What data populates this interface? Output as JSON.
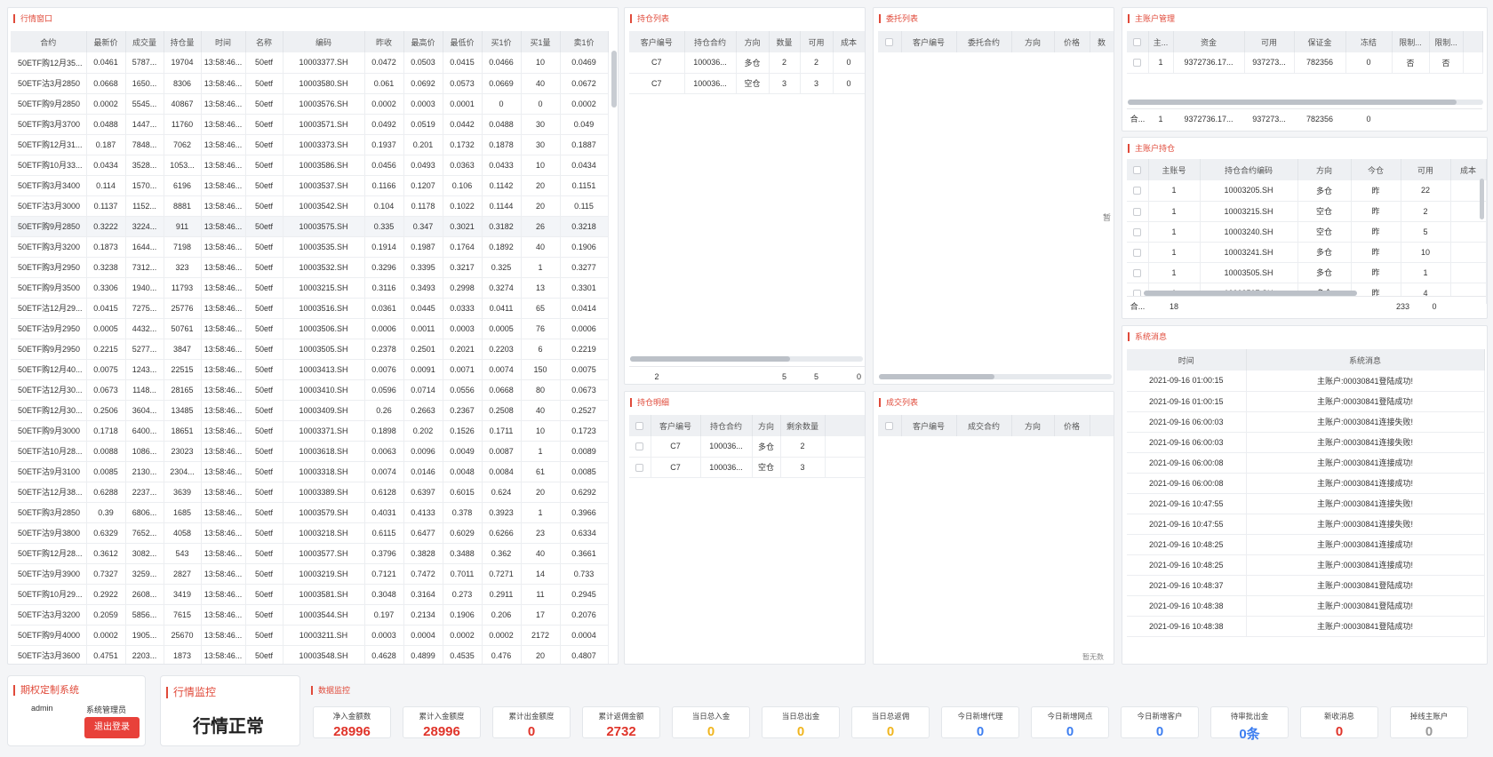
{
  "colors": {
    "accent": "#e04a3a",
    "red": "#e0342a",
    "yellow": "#f0b51e",
    "blue": "#3d7ef0",
    "gray": "#999999"
  },
  "market": {
    "title": "行情窗口",
    "headers": [
      "合约",
      "最新价",
      "成交量",
      "持仓量",
      "时间",
      "名称",
      "编码",
      "昨收",
      "最高价",
      "最低价",
      "买1价",
      "买1量",
      "卖1价"
    ],
    "rows": [
      [
        "50ETF购12月35...",
        "0.0461",
        "5787...",
        "19704",
        "13:58:46...",
        "50etf",
        "10003377.SH",
        "0.0472",
        "0.0503",
        "0.0415",
        "0.0466",
        "10",
        "0.0469"
      ],
      [
        "50ETF沽3月2850",
        "0.0668",
        "1650...",
        "8306",
        "13:58:46...",
        "50etf",
        "10003580.SH",
        "0.061",
        "0.0692",
        "0.0573",
        "0.0669",
        "40",
        "0.0672"
      ],
      [
        "50ETF购9月2850",
        "0.0002",
        "5545...",
        "40867",
        "13:58:46...",
        "50etf",
        "10003576.SH",
        "0.0002",
        "0.0003",
        "0.0001",
        "0",
        "0",
        "0.0002"
      ],
      [
        "50ETF购3月3700",
        "0.0488",
        "1447...",
        "11760",
        "13:58:46...",
        "50etf",
        "10003571.SH",
        "0.0492",
        "0.0519",
        "0.0442",
        "0.0488",
        "30",
        "0.049"
      ],
      [
        "50ETF购12月31...",
        "0.187",
        "7848...",
        "7062",
        "13:58:46...",
        "50etf",
        "10003373.SH",
        "0.1937",
        "0.201",
        "0.1732",
        "0.1878",
        "30",
        "0.1887"
      ],
      [
        "50ETF购10月33...",
        "0.0434",
        "3528...",
        "1053...",
        "13:58:46...",
        "50etf",
        "10003586.SH",
        "0.0456",
        "0.0493",
        "0.0363",
        "0.0433",
        "10",
        "0.0434"
      ],
      [
        "50ETF购3月3400",
        "0.114",
        "1570...",
        "6196",
        "13:58:46...",
        "50etf",
        "10003537.SH",
        "0.1166",
        "0.1207",
        "0.106",
        "0.1142",
        "20",
        "0.1151"
      ],
      [
        "50ETF沽3月3000",
        "0.1137",
        "1152...",
        "8881",
        "13:58:46...",
        "50etf",
        "10003542.SH",
        "0.104",
        "0.1178",
        "0.1022",
        "0.1144",
        "20",
        "0.115"
      ],
      [
        "50ETF购9月2850",
        "0.3222",
        "3224...",
        "911",
        "13:58:46...",
        "50etf",
        "10003575.SH",
        "0.335",
        "0.347",
        "0.3021",
        "0.3182",
        "26",
        "0.3218"
      ],
      [
        "50ETF购3月3200",
        "0.1873",
        "1644...",
        "7198",
        "13:58:46...",
        "50etf",
        "10003535.SH",
        "0.1914",
        "0.1987",
        "0.1764",
        "0.1892",
        "40",
        "0.1906"
      ],
      [
        "50ETF购3月2950",
        "0.3238",
        "7312...",
        "323",
        "13:58:46...",
        "50etf",
        "10003532.SH",
        "0.3296",
        "0.3395",
        "0.3217",
        "0.325",
        "1",
        "0.3277"
      ],
      [
        "50ETF购9月3500",
        "0.3306",
        "1940...",
        "11793",
        "13:58:46...",
        "50etf",
        "10003215.SH",
        "0.3116",
        "0.3493",
        "0.2998",
        "0.3274",
        "13",
        "0.3301"
      ],
      [
        "50ETF沽12月29...",
        "0.0415",
        "7275...",
        "25776",
        "13:58:46...",
        "50etf",
        "10003516.SH",
        "0.0361",
        "0.0445",
        "0.0333",
        "0.0411",
        "65",
        "0.0414"
      ],
      [
        "50ETF沽9月2950",
        "0.0005",
        "4432...",
        "50761",
        "13:58:46...",
        "50etf",
        "10003506.SH",
        "0.0006",
        "0.0011",
        "0.0003",
        "0.0005",
        "76",
        "0.0006"
      ],
      [
        "50ETF购9月2950",
        "0.2215",
        "5277...",
        "3847",
        "13:58:46...",
        "50etf",
        "10003505.SH",
        "0.2378",
        "0.2501",
        "0.2021",
        "0.2203",
        "6",
        "0.2219"
      ],
      [
        "50ETF购12月40...",
        "0.0075",
        "1243...",
        "22515",
        "13:58:46...",
        "50etf",
        "10003413.SH",
        "0.0076",
        "0.0091",
        "0.0071",
        "0.0074",
        "150",
        "0.0075"
      ],
      [
        "50ETF沽12月30...",
        "0.0673",
        "1148...",
        "28165",
        "13:58:46...",
        "50etf",
        "10003410.SH",
        "0.0596",
        "0.0714",
        "0.0556",
        "0.0668",
        "80",
        "0.0673"
      ],
      [
        "50ETF购12月30...",
        "0.2506",
        "3604...",
        "13485",
        "13:58:46...",
        "50etf",
        "10003409.SH",
        "0.26",
        "0.2663",
        "0.2367",
        "0.2508",
        "40",
        "0.2527"
      ],
      [
        "50ETF购9月3000",
        "0.1718",
        "6400...",
        "18651",
        "13:58:46...",
        "50etf",
        "10003371.SH",
        "0.1898",
        "0.202",
        "0.1526",
        "0.1711",
        "10",
        "0.1723"
      ],
      [
        "50ETF沽10月28...",
        "0.0088",
        "1086...",
        "23023",
        "13:58:46...",
        "50etf",
        "10003618.SH",
        "0.0063",
        "0.0096",
        "0.0049",
        "0.0087",
        "1",
        "0.0089"
      ],
      [
        "50ETF沽9月3100",
        "0.0085",
        "2130...",
        "2304...",
        "13:58:46...",
        "50etf",
        "10003318.SH",
        "0.0074",
        "0.0146",
        "0.0048",
        "0.0084",
        "61",
        "0.0085"
      ],
      [
        "50ETF沽12月38...",
        "0.6288",
        "2237...",
        "3639",
        "13:58:46...",
        "50etf",
        "10003389.SH",
        "0.6128",
        "0.6397",
        "0.6015",
        "0.624",
        "20",
        "0.6292"
      ],
      [
        "50ETF购3月2850",
        "0.39",
        "6806...",
        "1685",
        "13:58:46...",
        "50etf",
        "10003579.SH",
        "0.4031",
        "0.4133",
        "0.378",
        "0.3923",
        "1",
        "0.3966"
      ],
      [
        "50ETF沽9月3800",
        "0.6329",
        "7652...",
        "4058",
        "13:58:46...",
        "50etf",
        "10003218.SH",
        "0.6115",
        "0.6477",
        "0.6029",
        "0.6266",
        "23",
        "0.6334"
      ],
      [
        "50ETF购12月28...",
        "0.3612",
        "3082...",
        "543",
        "13:58:46...",
        "50etf",
        "10003577.SH",
        "0.3796",
        "0.3828",
        "0.3488",
        "0.362",
        "40",
        "0.3661"
      ],
      [
        "50ETF沽9月3900",
        "0.7327",
        "3259...",
        "2827",
        "13:58:46...",
        "50etf",
        "10003219.SH",
        "0.7121",
        "0.7472",
        "0.7011",
        "0.7271",
        "14",
        "0.733"
      ],
      [
        "50ETF购10月29...",
        "0.2922",
        "2608...",
        "3419",
        "13:58:46...",
        "50etf",
        "10003581.SH",
        "0.3048",
        "0.3164",
        "0.273",
        "0.2911",
        "11",
        "0.2945"
      ],
      [
        "50ETF沽3月3200",
        "0.2059",
        "5856...",
        "7615",
        "13:58:46...",
        "50etf",
        "10003544.SH",
        "0.197",
        "0.2134",
        "0.1906",
        "0.206",
        "17",
        "0.2076"
      ],
      [
        "50ETF购9月4000",
        "0.0002",
        "1905...",
        "25670",
        "13:58:46...",
        "50etf",
        "10003211.SH",
        "0.0003",
        "0.0004",
        "0.0002",
        "0.0002",
        "2172",
        "0.0004"
      ],
      [
        "50ETF沽3月3600",
        "0.4751",
        "2203...",
        "1873",
        "13:58:46...",
        "50etf",
        "10003548.SH",
        "0.4628",
        "0.4899",
        "0.4535",
        "0.476",
        "20",
        "0.4807"
      ]
    ]
  },
  "positions": {
    "title": "持仓列表",
    "headers": [
      "客户编号",
      "持仓合约",
      "方向",
      "数量",
      "可用",
      "成本"
    ],
    "rows": [
      [
        "C7",
        "100036...",
        "多仓",
        "2",
        "2",
        "0"
      ],
      [
        "C7",
        "100036...",
        "空仓",
        "3",
        "3",
        "0"
      ]
    ],
    "footer": [
      "2",
      "5",
      "5",
      "0"
    ]
  },
  "orders": {
    "title": "委托列表",
    "headers": [
      "客户编号",
      "委托合约",
      "方向",
      "价格",
      "数"
    ],
    "side_label": "暂"
  },
  "posdetail": {
    "title": "持仓明细",
    "headers": [
      "客户编号",
      "持仓合约",
      "方向",
      "剩余数量"
    ],
    "rows": [
      [
        "C7",
        "100036...",
        "多仓",
        "2"
      ],
      [
        "C7",
        "100036...",
        "空仓",
        "3"
      ]
    ]
  },
  "trades": {
    "title": "成交列表",
    "headers": [
      "客户编号",
      "成交合约",
      "方向",
      "价格"
    ],
    "empty": "暂无数"
  },
  "master": {
    "title": "主账户管理",
    "headers": [
      "主...",
      "资金",
      "可用",
      "保证金",
      "冻结",
      "限制...",
      "限制..."
    ],
    "rows": [
      [
        "1",
        "9372736.17...",
        "937273...",
        "782356",
        "0",
        "否",
        "否"
      ]
    ],
    "summary": [
      "合...",
      "1",
      "9372736.17...",
      "937273...",
      "782356",
      "0"
    ]
  },
  "masterpos": {
    "title": "主账户持仓",
    "headers": [
      "主账号",
      "持仓合约编码",
      "方向",
      "今仓",
      "可用",
      "成本"
    ],
    "rows": [
      [
        "1",
        "10003205.SH",
        "多仓",
        "昨",
        "22"
      ],
      [
        "1",
        "10003215.SH",
        "空仓",
        "昨",
        "2"
      ],
      [
        "1",
        "10003240.SH",
        "空仓",
        "昨",
        "5"
      ],
      [
        "1",
        "10003241.SH",
        "多仓",
        "昨",
        "10"
      ],
      [
        "1",
        "10003505.SH",
        "多仓",
        "昨",
        "1"
      ],
      [
        "1",
        "10003507.SH",
        "多仓",
        "昨",
        "4"
      ]
    ],
    "summary": [
      "合...",
      "18",
      "233",
      "0"
    ]
  },
  "sysmsg": {
    "title": "系统消息",
    "headers": [
      "时间",
      "系统消息"
    ],
    "rows": [
      [
        "2021-09-16 01:00:15",
        "主账户:00030841登陆成功!"
      ],
      [
        "2021-09-16 01:00:15",
        "主账户:00030841登陆成功!"
      ],
      [
        "2021-09-16 06:00:03",
        "主账户:00030841连接失败!"
      ],
      [
        "2021-09-16 06:00:03",
        "主账户:00030841连接失败!"
      ],
      [
        "2021-09-16 06:00:08",
        "主账户:00030841连接成功!"
      ],
      [
        "2021-09-16 06:00:08",
        "主账户:00030841连接成功!"
      ],
      [
        "2021-09-16 10:47:55",
        "主账户:00030841连接失败!"
      ],
      [
        "2021-09-16 10:47:55",
        "主账户:00030841连接失败!"
      ],
      [
        "2021-09-16 10:48:25",
        "主账户:00030841连接成功!"
      ],
      [
        "2021-09-16 10:48:25",
        "主账户:00030841连接成功!"
      ],
      [
        "2021-09-16 10:48:37",
        "主账户:00030841登陆成功!"
      ],
      [
        "2021-09-16 10:48:38",
        "主账户:00030841登陆成功!"
      ],
      [
        "2021-09-16 10:48:38",
        "主账户:00030841登陆成功!"
      ]
    ]
  },
  "system": {
    "name": "期权定制系统",
    "user": "admin",
    "role": "系统管理员",
    "logout": "退出登录"
  },
  "monitor": {
    "title": "行情监控",
    "status": "行情正常"
  },
  "datamon": {
    "title": "数据监控",
    "items": [
      {
        "label": "净入金额数",
        "value": "28996",
        "color": "red"
      },
      {
        "label": "累计入金额度",
        "value": "28996",
        "color": "red"
      },
      {
        "label": "累计出金额度",
        "value": "0",
        "color": "red"
      },
      {
        "label": "累计返佣金额",
        "value": "2732",
        "color": "red"
      },
      {
        "label": "当日总入金",
        "value": "0",
        "color": "yellow"
      },
      {
        "label": "当日总出金",
        "value": "0",
        "color": "yellow"
      },
      {
        "label": "当日总返佣",
        "value": "0",
        "color": "yellow"
      },
      {
        "label": "今日新增代理",
        "value": "0",
        "color": "blue"
      },
      {
        "label": "今日新增网点",
        "value": "0",
        "color": "blue"
      },
      {
        "label": "今日新增客户",
        "value": "0",
        "color": "blue"
      },
      {
        "label": "待审批出金",
        "value": "0条",
        "color": "blue"
      },
      {
        "label": "新收消息",
        "value": "0",
        "color": "red"
      },
      {
        "label": "掉线主账户",
        "value": "0",
        "color": "gray"
      }
    ]
  }
}
